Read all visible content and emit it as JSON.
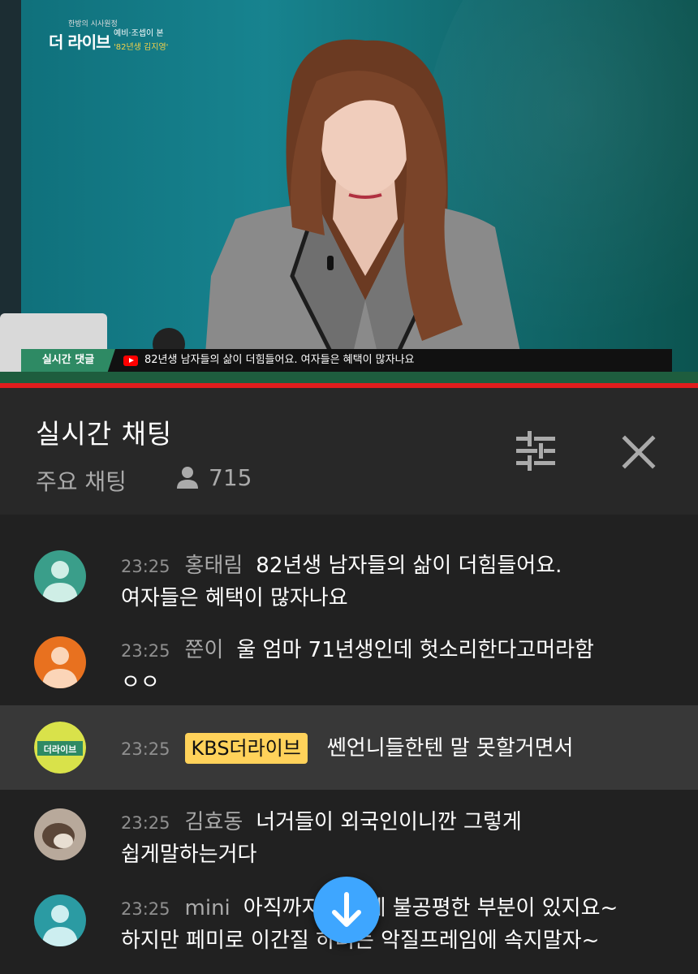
{
  "video": {
    "logo_small": "한방의 시사원정 ",
    "logo_big": "더 라이브",
    "logo_sub1": "예비·조셉이 본",
    "logo_sub2": "'82년생 김지영'",
    "ticker_tag": "실시간 댓글",
    "ticker_message": "82년생 남자들의 삶이 더힘들어요. 여자들은 혜택이 많자나요",
    "progress_color": "#e01d1d"
  },
  "chat_header": {
    "title": "실시간 채팅",
    "mode": "주요 채팅",
    "viewer_count": "715",
    "icons": [
      "person-icon",
      "filter-icon",
      "close-icon"
    ]
  },
  "messages": [
    {
      "time": "23:25",
      "author": "홍태림",
      "line1": "82년생 남자들의 삶이 더힘들어요.",
      "line2": "여자들은 혜택이 많자나요",
      "avatar_color": "#3a9e8a"
    },
    {
      "time": "23:25",
      "author": "쭌이",
      "line1": "울 엄마 71년생인데 헛소리한다고머라함",
      "line2": "ㅇㅇ",
      "avatar_color": "#e8711f"
    },
    {
      "time": "23:25",
      "author": "KBS더라이브",
      "line1": "쎈언니들한텐 말 못할거면서",
      "line2": "",
      "avatar_color": "#d9e24a"
    },
    {
      "time": "23:25",
      "author": "김효동",
      "line1": "너거들이 외국인이니깐 그렇게",
      "line2": "쉽게말하는거다",
      "avatar_color": "#8c7a6d"
    },
    {
      "time": "23:25",
      "author": "mini",
      "line1": "아직까지 사회에 불공평한 부분이 있지요~",
      "line2": "하지만 페미로 이간질 하려는 악질프레임에 속지말자~",
      "avatar_color": "#2b9ba3"
    }
  ],
  "pinned_badge_color": "#ffd25a",
  "scroll_button_color": "#3ea6ff"
}
